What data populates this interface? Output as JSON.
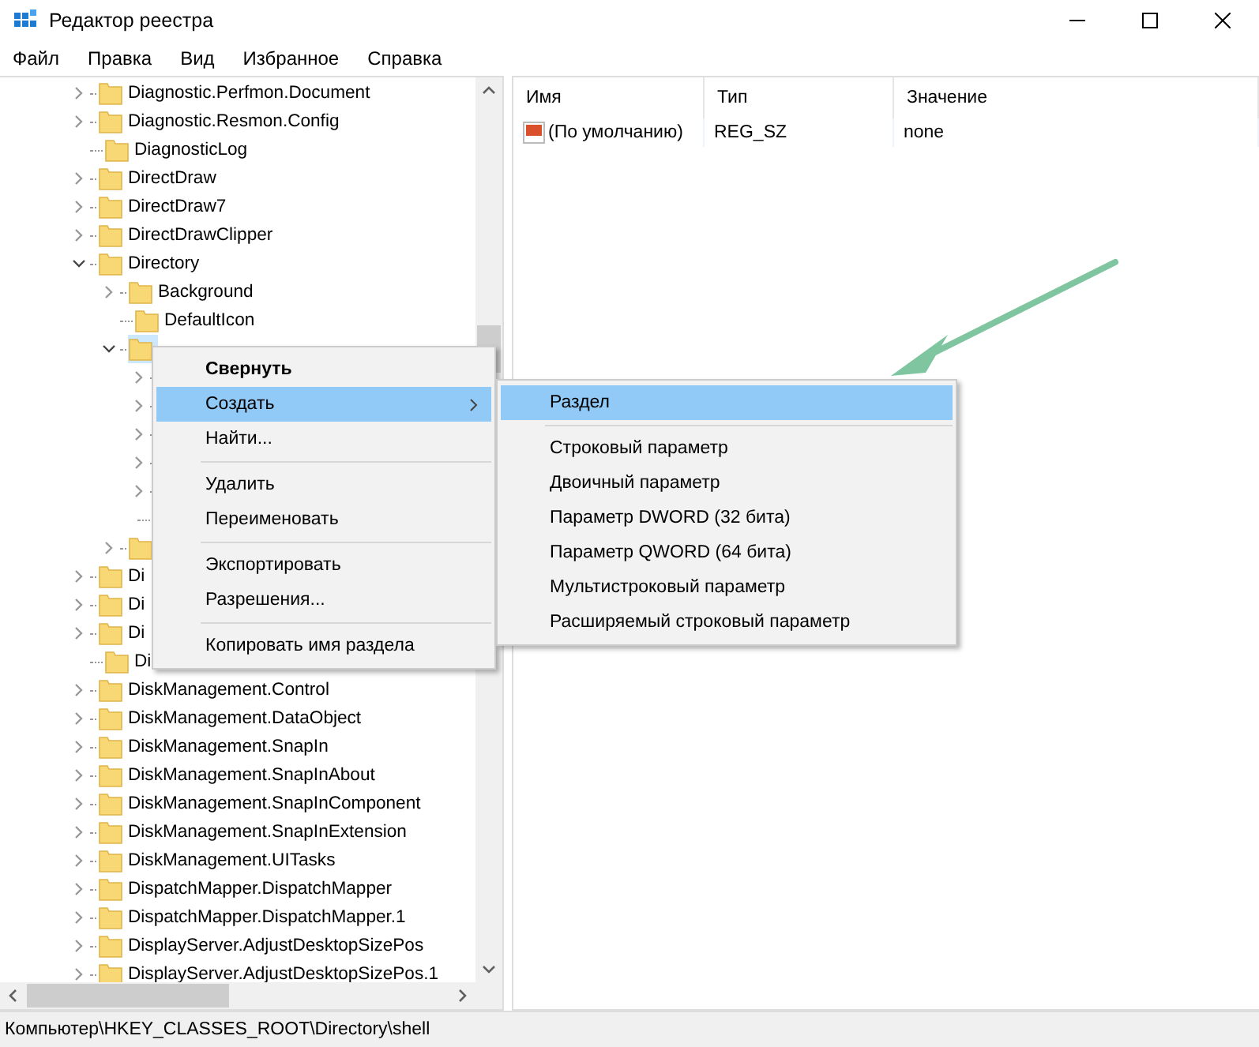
{
  "window": {
    "title": "Редактор реестра"
  },
  "menu_bar": [
    "Файл",
    "Правка",
    "Вид",
    "Избранное",
    "Справка"
  ],
  "tree": {
    "items": [
      {
        "label": "Diagnostic.Perfmon.Document",
        "expanded": false,
        "selected": false
      },
      {
        "label": "Diagnostic.Resmon.Config",
        "expanded": false,
        "selected": false
      },
      {
        "label": "DiagnosticLog",
        "selected": false
      },
      {
        "label": "DirectDraw",
        "expanded": false,
        "selected": false
      },
      {
        "label": "DirectDraw7",
        "expanded": false,
        "selected": false
      },
      {
        "label": "DirectDrawClipper",
        "expanded": false,
        "selected": false
      },
      {
        "label": "Directory",
        "expanded": true,
        "selected": false,
        "children": [
          {
            "label": "Background",
            "expanded": false,
            "selected": false
          },
          {
            "label": "DefaultIcon",
            "selected": false
          },
          {
            "expanded": true,
            "selected": true,
            "children": [
              {
                "expanded": false
              },
              {
                "expanded": false
              },
              {
                "expanded": false
              },
              {
                "expanded": false
              },
              {
                "expanded": false
              },
              {
                "kind": "leaf"
              }
            ]
          },
          {
            "expanded": false,
            "selected": false
          }
        ]
      },
      {
        "label": "Di",
        "expanded": false,
        "selected": false
      },
      {
        "label": "Di",
        "expanded": false,
        "selected": false
      },
      {
        "label": "Di",
        "expanded": false,
        "selected": false
      },
      {
        "label": "Di",
        "selected": false
      },
      {
        "label": "DiskManagement.Control",
        "expanded": false,
        "selected": false
      },
      {
        "label": "DiskManagement.DataObject",
        "expanded": false,
        "selected": false
      },
      {
        "label": "DiskManagement.SnapIn",
        "expanded": false,
        "selected": false
      },
      {
        "label": "DiskManagement.SnapInAbout",
        "expanded": false,
        "selected": false
      },
      {
        "label": "DiskManagement.SnapInComponent",
        "expanded": false,
        "selected": false
      },
      {
        "label": "DiskManagement.SnapInExtension",
        "expanded": false,
        "selected": false
      },
      {
        "label": "DiskManagement.UITasks",
        "expanded": false,
        "selected": false
      },
      {
        "label": "DispatchMapper.DispatchMapper",
        "expanded": false,
        "selected": false
      },
      {
        "label": "DispatchMapper.DispatchMapper.1",
        "expanded": false,
        "selected": false
      },
      {
        "label": "DisplayServer.AdjustDesktopSizePos",
        "expanded": false,
        "selected": false
      },
      {
        "label": "DisplayServer.AdjustDesktopSizePos.1",
        "expanded": false,
        "selected": false
      }
    ]
  },
  "values": {
    "columns": [
      "Имя",
      "Тип",
      "Значение"
    ],
    "rows": [
      {
        "name": "(По умолчанию)",
        "type": "REG_SZ",
        "value": "none"
      }
    ]
  },
  "context_menu": {
    "items": [
      {
        "kind": "item",
        "label": "Свернуть",
        "bold": true,
        "selected": false
      },
      {
        "kind": "submenu",
        "label": "Создать",
        "bold": false,
        "selected": true
      },
      {
        "kind": "item",
        "label": "Найти...",
        "bold": false,
        "selected": false
      },
      {
        "kind": "separator"
      },
      {
        "kind": "item",
        "label": "Удалить",
        "bold": false,
        "selected": false
      },
      {
        "kind": "item",
        "label": "Переименовать",
        "bold": false,
        "selected": false
      },
      {
        "kind": "separator"
      },
      {
        "kind": "item",
        "label": "Экспортировать",
        "bold": false,
        "selected": false
      },
      {
        "kind": "item",
        "label": "Разрешения...",
        "bold": false,
        "selected": false
      },
      {
        "kind": "separator"
      },
      {
        "kind": "item",
        "label": "Копировать имя раздела",
        "bold": false,
        "selected": false
      }
    ]
  },
  "submenu": {
    "items": [
      {
        "kind": "item",
        "label": "Раздел",
        "selected": true
      },
      {
        "kind": "separator"
      },
      {
        "kind": "item",
        "label": "Строковый параметр",
        "selected": false
      },
      {
        "kind": "item",
        "label": "Двоичный параметр",
        "selected": false
      },
      {
        "kind": "item",
        "label": "Параметр DWORD (32 бита)",
        "selected": false
      },
      {
        "kind": "item",
        "label": "Параметр QWORD (64 бита)",
        "selected": false
      },
      {
        "kind": "item",
        "label": "Мультистроковый параметр",
        "selected": false
      },
      {
        "kind": "item",
        "label": "Расширяемый строковый параметр",
        "selected": false
      }
    ]
  },
  "status_bar": "Компьютер\\HKEY_CLASSES_ROOT\\Directory\\shell"
}
